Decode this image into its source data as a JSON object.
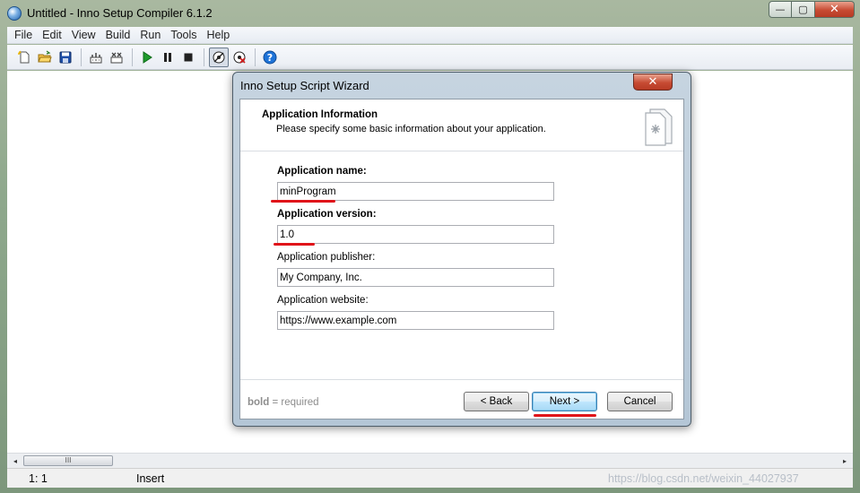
{
  "window": {
    "title": "Untitled - Inno Setup Compiler 6.1.2",
    "controls": {
      "minimize": "—",
      "maximize": "▢",
      "close": "✕"
    }
  },
  "menu": [
    "File",
    "Edit",
    "View",
    "Build",
    "Run",
    "Tools",
    "Help"
  ],
  "toolbar": {
    "icons": [
      "new-file-icon",
      "open-folder-icon",
      "save-icon",
      "compile-icon",
      "stop-compile-icon",
      "run-icon",
      "pause-icon",
      "terminate-icon",
      "target-setup-icon",
      "target-uninstall-icon",
      "help-icon"
    ]
  },
  "status": {
    "position": "1:   1",
    "mode": "Insert",
    "watermark": "https://blog.csdn.net/weixin_44027937"
  },
  "scroll": {
    "left_arrow": "◂",
    "right_arrow": "▸",
    "thumb_grip": "III"
  },
  "wizard": {
    "title": "Inno Setup Script Wizard",
    "close_glyph": "✕",
    "header_title": "Application Information",
    "header_desc": "Please specify some basic information about your application.",
    "fields": [
      {
        "label": "Application name:",
        "value": "minProgram",
        "bold": true
      },
      {
        "label": "Application version:",
        "value": "1.0",
        "bold": true
      },
      {
        "label": "Application publisher:",
        "value": "My Company, Inc.",
        "bold": false
      },
      {
        "label": "Application website:",
        "value": "https://www.example.com",
        "bold": false
      }
    ],
    "footer_note_bold": "bold",
    "footer_note_rest": " = required",
    "buttons": {
      "back": "< Back",
      "next": "Next >",
      "cancel": "Cancel"
    },
    "colors": {
      "annotation": "#e0141a"
    }
  }
}
